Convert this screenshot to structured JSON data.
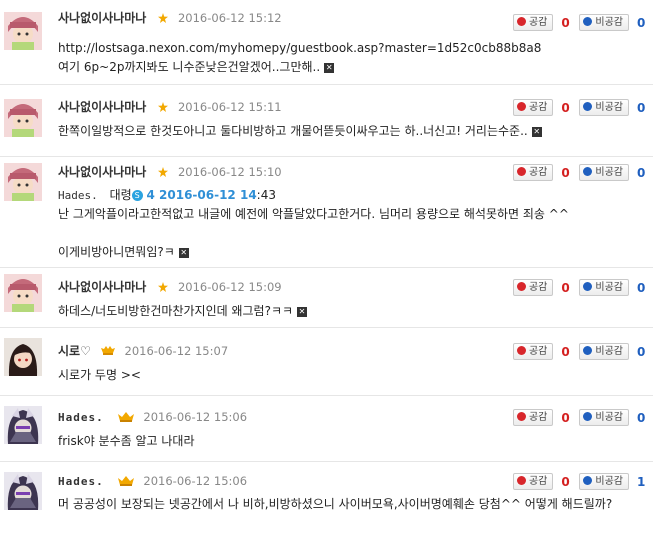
{
  "vote": {
    "like_label": "공감",
    "dislike_label": "비공감"
  },
  "comments": [
    {
      "nick": "사나없이사나마나",
      "date": "2016-06-12 15:12",
      "lines": [
        "http://lostsaga.nexon.com/myhomepy/guestbook.asp?master=1d52c0cb88b8a8",
        "여기 6p~2p까지봐도 니수준낮은건알겠어..그만해.."
      ],
      "like": "0",
      "dislike": "0"
    },
    {
      "nick": "사나없이사나마나",
      "date": "2016-06-12 15:11",
      "lines": [
        "한쪽이일방적으로 한것도아니고 둘다비방하고 개물어뜯듯이싸우고는 하..너신고! 거리는수준.."
      ],
      "like": "0",
      "dislike": "0"
    },
    {
      "nick": "사나없이사나마나",
      "date": "2016-06-12 15:10",
      "reply_to": "Hades.",
      "reply_rank": "대령",
      "reply_ref": "4 2016-06-12 14",
      "reply_ref_tail": ":43",
      "lines": [
        "난 그게악플이라고한적없고 내글에 예전에 악플달았다고한거다. 님머리 용량으로 해석못하면 죄송 ^^",
        "",
        "이게비방아니면뭐임?ㅋ"
      ],
      "like": "0",
      "dislike": "0"
    },
    {
      "nick": "사나없이사나마나",
      "date": "2016-06-12 15:09",
      "lines": [
        "하데스/너도비방한건마찬가지인데 왜그럼?ㅋㅋ"
      ],
      "like": "0",
      "dislike": "0"
    },
    {
      "nick": "시로♡",
      "date": "2016-06-12 15:07",
      "lines": [
        "시로가 두명 ><"
      ],
      "like": "0",
      "dislike": "0"
    },
    {
      "nick": "Hades.",
      "date": "2016-06-12 15:06",
      "lines": [
        "frisk야 분수좀 알고 나대라"
      ],
      "like": "0",
      "dislike": "0"
    },
    {
      "nick": "Hades.",
      "date": "2016-06-12 15:06",
      "lines": [
        "머 공공성이 보장되는 넷공간에서 나 비하,비방하셨으니 사이버모욕,사이버명예훼손 당첨^^ 어떻게 해드릴까?"
      ],
      "like": "0",
      "dislike": "1"
    }
  ]
}
